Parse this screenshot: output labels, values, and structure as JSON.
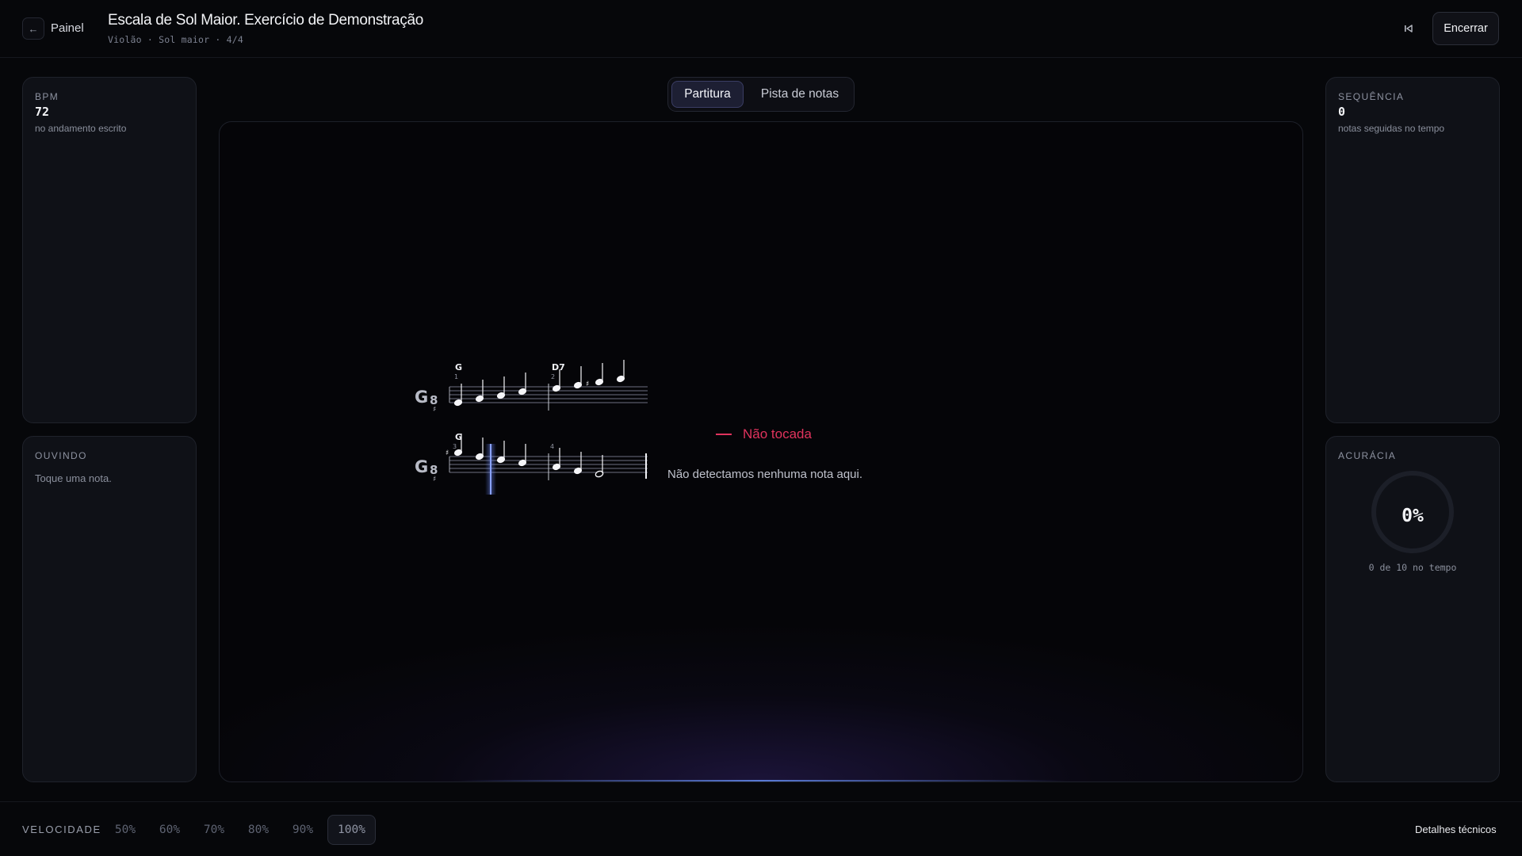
{
  "header": {
    "back_label": "Painel",
    "title": "Escala de Sol Maior. Exercício de Demonstração",
    "subtitle": "Violão · Sol maior · 4/4",
    "end_label": "Encerrar"
  },
  "panels": {
    "bpm": {
      "label": "BPM",
      "value": "72",
      "note": "no andamento escrito"
    },
    "listening": {
      "label": "OUVINDO",
      "hint": "Toque uma nota."
    },
    "streak": {
      "label": "SEQUÊNCIA",
      "value": "0",
      "note": "notas seguidas no tempo"
    },
    "accuracy": {
      "label": "ACURÁCIA",
      "value": "0%",
      "caption": "0 de 10 no tempo",
      "fraction": 0
    }
  },
  "view_tabs": {
    "active": "Partitura",
    "other": "Pista de notas"
  },
  "score": {
    "clef_label": "G",
    "clef_sub": "8",
    "key_mark": "♯",
    "row1": {
      "chords": [
        "G",
        "D7"
      ],
      "measures": [
        "1",
        "2"
      ]
    },
    "row2": {
      "chords": [
        "G"
      ],
      "measures": [
        "3",
        "4"
      ]
    }
  },
  "feedback": {
    "status": "Não tocada",
    "message": "Não detectamos nenhuma nota aqui."
  },
  "footer": {
    "speed_label": "VELOCIDADE",
    "speeds": [
      "50%",
      "60%",
      "70%",
      "80%",
      "90%",
      "100%"
    ],
    "selected_speed": "100%",
    "tech_label": "Detalhes técnicos"
  },
  "colors": {
    "accent": "#3a3d64",
    "error": "#e0335d",
    "playhead": "#6f8cff"
  }
}
